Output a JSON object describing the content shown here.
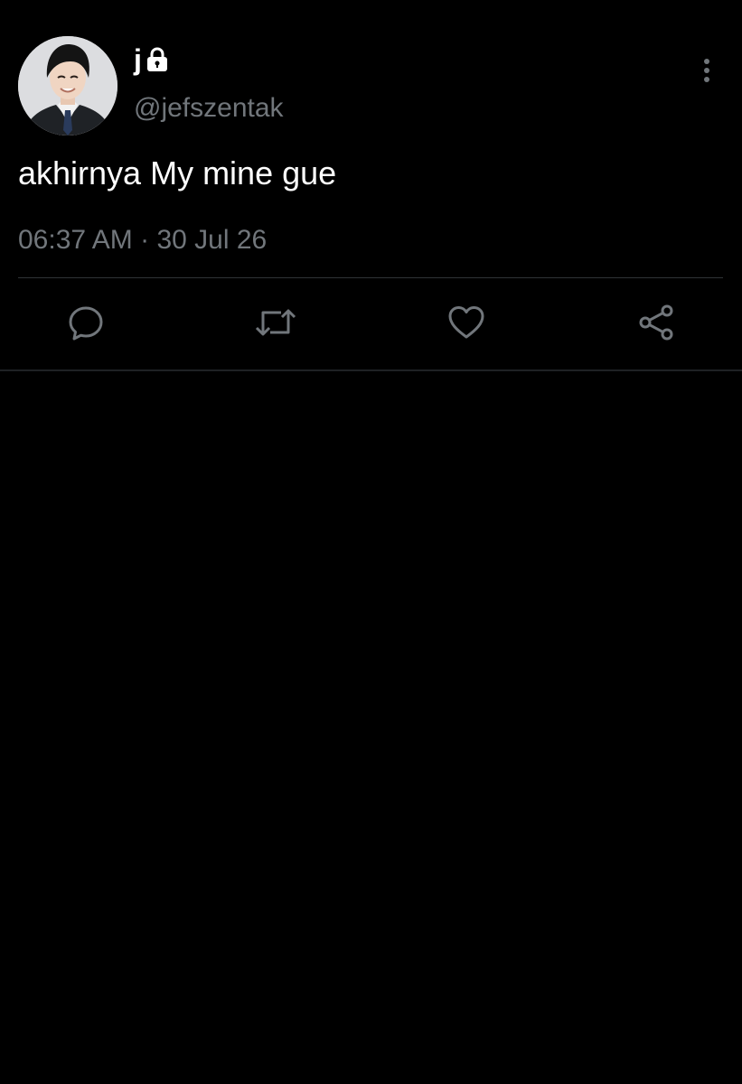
{
  "tweet": {
    "display_name": "j",
    "handle": "@jefszentak",
    "text": "akhirnya My mine gue",
    "time": "06:37 AM",
    "separator": "·",
    "date": "30 Jul 26",
    "protected_icon": "lock-icon",
    "more_icon": "more-vertical-icon",
    "avatar": "profile-avatar"
  },
  "actions": [
    {
      "name": "reply",
      "icon": "reply-icon"
    },
    {
      "name": "retweet",
      "icon": "retweet-icon"
    },
    {
      "name": "like",
      "icon": "heart-icon"
    },
    {
      "name": "share",
      "icon": "share-icon"
    }
  ],
  "colors": {
    "background": "#000000",
    "primary_text": "#ffffff",
    "secondary_text": "#71767b",
    "divider": "#2f3336",
    "icon": "#71767b"
  }
}
